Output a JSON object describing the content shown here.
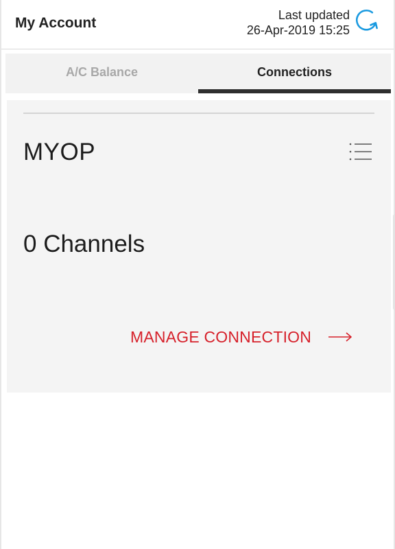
{
  "header": {
    "title": "My Account",
    "last_updated_label": "Last updated",
    "last_updated_value": "26-Apr-2019 15:25",
    "refresh_icon": "refresh-icon"
  },
  "tabs": [
    {
      "label": "A/C Balance",
      "active": false
    },
    {
      "label": "Connections",
      "active": true
    }
  ],
  "connection": {
    "name": "MYOP",
    "menu_icon": "list-menu-icon",
    "channels": "0 Channels",
    "manage_label": "MANAGE CONNECTION",
    "arrow_icon": "arrow-right-icon"
  },
  "colors": {
    "accent_red": "#d6202a",
    "refresh_blue": "#1a9ae0",
    "tab_active_underline": "#2f2f2f"
  }
}
